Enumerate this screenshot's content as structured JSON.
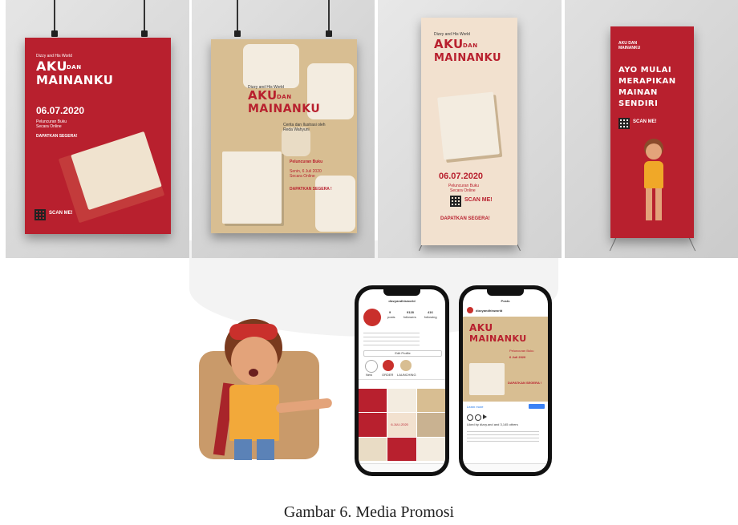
{
  "posters": {
    "poster1": {
      "kicker": "Dizzy and His World",
      "title_line1": "AKU",
      "title_dan": "DAN",
      "title_line2": "MAINANKU",
      "date": "06.07.2020",
      "sub1": "Peluncuran Buku",
      "sub2": "Secara Online",
      "cta": "DAPATKAN SEGERA!",
      "scan": "SCAN ME!"
    },
    "poster2": {
      "kicker": "Dizzy and His World",
      "title_line1": "AKU",
      "title_dan": "DAN",
      "title_line2": "MAINANKU",
      "author": "Cerita dan Ilustrasi oleh Reda Wahyuni",
      "launch": "Peluncuran Buku",
      "date": "Senin, 6 Juli 2020",
      "sub": "Secara Online",
      "cta": "DAPATKAN SEGERA !"
    },
    "poster3": {
      "kicker": "Dizzy and His World",
      "title_line1": "AKU",
      "title_dan": "DAN",
      "title_line2": "MAINANKU",
      "date": "06.07.2020",
      "sub1": "Peluncuran Buku",
      "sub2": "Secara Online",
      "scan": "SCAN ME!",
      "cta": "DAPATKAN SEGERA!"
    },
    "poster4": {
      "kicker": "AKU DAN MAINANKU",
      "line1": "AYO MULAI",
      "line2": "MERAPIKAN",
      "line3": "MAINAN",
      "line4": "SENDIRI",
      "scan": "SCAN ME!"
    }
  },
  "phone1": {
    "username": "dizzyandhisworld",
    "posts": "9",
    "posts_label": "posts",
    "followers": "9128",
    "followers_label": "followers",
    "following": "416",
    "following_label": "following",
    "edit": "Edit Profile",
    "highlight1": "New",
    "highlight2": "ORDER",
    "highlight3": "LAUNCHING",
    "post_date": "6.JULI.2020"
  },
  "phone2": {
    "header": "Posts",
    "username": "dizzyandhisworld",
    "post_title1": "AKU",
    "post_title2": "MAINANKU",
    "post_launch": "Peluncuran Buku",
    "post_date": "6 Juli 2020",
    "post_cta": "DAPATKAN SEGERA !",
    "learn_more": "Learn more",
    "likes": "Liked by dizzy.and and 3,145 others"
  },
  "caption": "Gambar 6. Media Promosi"
}
